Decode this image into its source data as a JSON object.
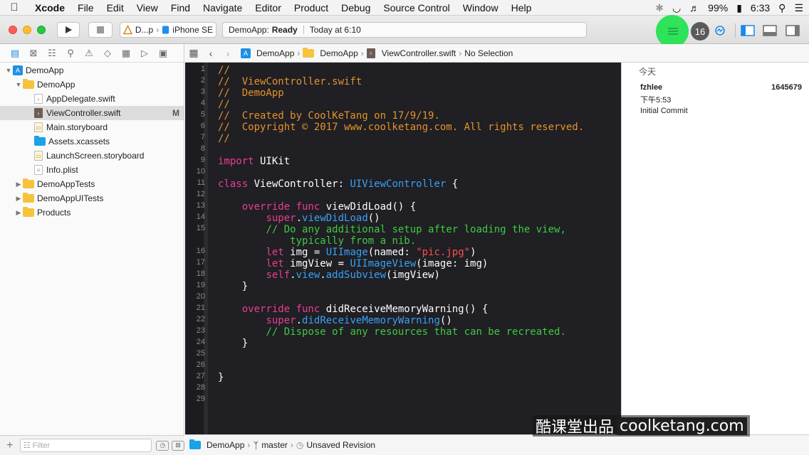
{
  "menubar": {
    "items": [
      "Xcode",
      "File",
      "Edit",
      "View",
      "Find",
      "Navigate",
      "Editor",
      "Product",
      "Debug",
      "Source Control",
      "Window",
      "Help"
    ],
    "battery": "99%",
    "clock": "6:33"
  },
  "toolbar": {
    "scheme_app": "D...p",
    "scheme_device": "iPhone SE",
    "activity_app": "DemoApp:",
    "activity_status": "Ready",
    "activity_time": "Today at 6:10",
    "badge_count": "16"
  },
  "navigator": {
    "rows": [
      {
        "label": "DemoApp",
        "kind": "project",
        "indent": 6,
        "tri": "▼"
      },
      {
        "label": "DemoApp",
        "kind": "folder",
        "indent": 20,
        "tri": "▼"
      },
      {
        "label": "AppDelegate.swift",
        "kind": "swift",
        "indent": 48,
        "tri": ""
      },
      {
        "label": "ViewController.swift",
        "kind": "swiftdark",
        "indent": 48,
        "tri": "",
        "selected": true,
        "status": "M"
      },
      {
        "label": "Main.storyboard",
        "kind": "sb",
        "indent": 48,
        "tri": ""
      },
      {
        "label": "Assets.xcassets",
        "kind": "bluefolder",
        "indent": 48,
        "tri": ""
      },
      {
        "label": "LaunchScreen.storyboard",
        "kind": "sb",
        "indent": 48,
        "tri": ""
      },
      {
        "label": "Info.plist",
        "kind": "pl",
        "indent": 48,
        "tri": ""
      },
      {
        "label": "DemoAppTests",
        "kind": "folder",
        "indent": 20,
        "tri": "▶"
      },
      {
        "label": "DemoAppUITests",
        "kind": "folder",
        "indent": 20,
        "tri": "▶"
      },
      {
        "label": "Products",
        "kind": "folder",
        "indent": 20,
        "tri": "▶"
      }
    ],
    "filter_placeholder": "Filter"
  },
  "jumpbar": {
    "project": "DemoApp",
    "group": "DemoApp",
    "file": "ViewController.swift",
    "selection": "No Selection"
  },
  "editor": {
    "lines": [
      {
        "n": "1",
        "parts": [
          [
            "c-com",
            "//"
          ]
        ]
      },
      {
        "n": "2",
        "parts": [
          [
            "c-com",
            "//  ViewController.swift"
          ]
        ]
      },
      {
        "n": "3",
        "parts": [
          [
            "c-com",
            "//  DemoApp"
          ]
        ]
      },
      {
        "n": "4",
        "parts": [
          [
            "c-com",
            "//"
          ]
        ]
      },
      {
        "n": "5",
        "parts": [
          [
            "c-com",
            "//  Created by CoolKeTang on 17/9/19."
          ]
        ]
      },
      {
        "n": "6",
        "parts": [
          [
            "c-com",
            "//  Copyright © 2017 www.coolketang.com. All rights reserved."
          ]
        ]
      },
      {
        "n": "7",
        "parts": [
          [
            "c-com",
            "//"
          ]
        ]
      },
      {
        "n": "8",
        "parts": []
      },
      {
        "n": "9",
        "parts": [
          [
            "c-kw",
            "import"
          ],
          [
            "c-plain",
            " UIKit"
          ]
        ]
      },
      {
        "n": "10",
        "parts": []
      },
      {
        "n": "11",
        "parts": [
          [
            "c-kw",
            "class"
          ],
          [
            "c-plain",
            " ViewController: "
          ],
          [
            "c-type",
            "UIViewController"
          ],
          [
            "c-plain",
            " {"
          ]
        ]
      },
      {
        "n": "12",
        "parts": []
      },
      {
        "n": "13",
        "parts": [
          [
            "c-plain",
            "    "
          ],
          [
            "c-kw",
            "override func"
          ],
          [
            "c-plain",
            " viewDidLoad() {"
          ]
        ]
      },
      {
        "n": "14",
        "parts": [
          [
            "c-plain",
            "        "
          ],
          [
            "c-kw",
            "super"
          ],
          [
            "c-plain",
            "."
          ],
          [
            "c-type",
            "viewDidLoad"
          ],
          [
            "c-plain",
            "()"
          ]
        ]
      },
      {
        "n": "15",
        "parts": [
          [
            "c-plain",
            "        "
          ],
          [
            "c-com2",
            "// Do any additional setup after loading the view,"
          ]
        ]
      },
      {
        "n": "",
        "parts": [
          [
            "c-plain",
            "            "
          ],
          [
            "c-com2",
            "typically from a nib."
          ]
        ]
      },
      {
        "n": "16",
        "parts": [
          [
            "c-plain",
            "        "
          ],
          [
            "c-kw",
            "let"
          ],
          [
            "c-plain",
            " img = "
          ],
          [
            "c-type",
            "UIImage"
          ],
          [
            "c-plain",
            "(named: "
          ],
          [
            "c-str",
            "\"pic.jpg\""
          ],
          [
            "c-plain",
            ")"
          ]
        ]
      },
      {
        "n": "17",
        "parts": [
          [
            "c-plain",
            "        "
          ],
          [
            "c-kw",
            "let"
          ],
          [
            "c-plain",
            " imgView = "
          ],
          [
            "c-type",
            "UIImageView"
          ],
          [
            "c-plain",
            "(image: img)"
          ]
        ]
      },
      {
        "n": "18",
        "parts": [
          [
            "c-plain",
            "        "
          ],
          [
            "c-kw",
            "self"
          ],
          [
            "c-plain",
            "."
          ],
          [
            "c-type",
            "view"
          ],
          [
            "c-plain",
            "."
          ],
          [
            "c-type",
            "addSubview"
          ],
          [
            "c-plain",
            "(imgView)"
          ]
        ]
      },
      {
        "n": "19",
        "parts": [
          [
            "c-plain",
            "    }"
          ]
        ]
      },
      {
        "n": "20",
        "parts": []
      },
      {
        "n": "21",
        "parts": [
          [
            "c-plain",
            "    "
          ],
          [
            "c-kw",
            "override func"
          ],
          [
            "c-plain",
            " didReceiveMemoryWarning() {"
          ]
        ]
      },
      {
        "n": "22",
        "parts": [
          [
            "c-plain",
            "        "
          ],
          [
            "c-kw",
            "super"
          ],
          [
            "c-plain",
            "."
          ],
          [
            "c-type",
            "didReceiveMemoryWarning"
          ],
          [
            "c-plain",
            "()"
          ]
        ]
      },
      {
        "n": "23",
        "parts": [
          [
            "c-plain",
            "        "
          ],
          [
            "c-com2",
            "// Dispose of any resources that can be recreated."
          ]
        ]
      },
      {
        "n": "24",
        "parts": [
          [
            "c-plain",
            "    }"
          ]
        ]
      },
      {
        "n": "25",
        "parts": []
      },
      {
        "n": "26",
        "parts": []
      },
      {
        "n": "27",
        "parts": [
          [
            "c-plain",
            "}"
          ]
        ]
      },
      {
        "n": "28",
        "parts": []
      },
      {
        "n": "29",
        "parts": []
      }
    ]
  },
  "history": {
    "today": "今天",
    "author": "fzhlee",
    "hash": "1645679",
    "time": "下午5:53",
    "message": "Initial Commit"
  },
  "bottombar": {
    "project": "DemoApp",
    "branch": "master",
    "revision": "Unsaved Revision"
  },
  "watermark": {
    "cn": "酷课堂出品",
    "en": "coolketang.com"
  },
  "colors": {
    "comment": "#e5922a",
    "keyword": "#ea3d92",
    "type": "#38a2f4",
    "string": "#fb4f4f",
    "doc": "#41c940"
  }
}
